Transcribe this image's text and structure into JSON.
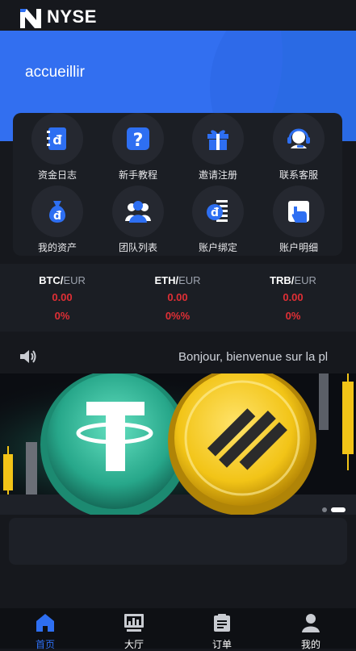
{
  "header": {
    "brand": "NYSE",
    "logo_icon": "nyse-logo-icon"
  },
  "hero": {
    "welcome": "accueillir"
  },
  "menu": {
    "items": [
      {
        "label": "资金日志",
        "icon": "fund-log-icon"
      },
      {
        "label": "新手教程",
        "icon": "help-icon"
      },
      {
        "label": "邀请注册",
        "icon": "gift-icon"
      },
      {
        "label": "联系客服",
        "icon": "headset-icon"
      },
      {
        "label": "我的资产",
        "icon": "money-bag-icon"
      },
      {
        "label": "团队列表",
        "icon": "team-icon"
      },
      {
        "label": "账户绑定",
        "icon": "account-bind-icon"
      },
      {
        "label": "账户明细",
        "icon": "account-detail-icon"
      }
    ]
  },
  "tickers": [
    {
      "base": "BTC/",
      "quote": "EUR",
      "price": "0.00",
      "change": "0%"
    },
    {
      "base": "ETH/",
      "quote": "EUR",
      "price": "0.00",
      "change": "0%%"
    },
    {
      "base": "TRB/",
      "quote": "EUR",
      "price": "0.00",
      "change": "0%"
    }
  ],
  "notice": {
    "text": "Bonjour, bienvenue sur la pl",
    "icon": "speaker-icon"
  },
  "banner": {
    "slide_count": 2,
    "active_slide": 1
  },
  "tabbar": {
    "items": [
      {
        "label": "首页",
        "icon": "home-icon"
      },
      {
        "label": "大厅",
        "icon": "hall-icon"
      },
      {
        "label": "订单",
        "icon": "order-icon"
      },
      {
        "label": "我的",
        "icon": "user-icon"
      }
    ]
  },
  "colors": {
    "accent": "#2e6ff2",
    "down": "#e02f35",
    "background": "#16181d"
  }
}
